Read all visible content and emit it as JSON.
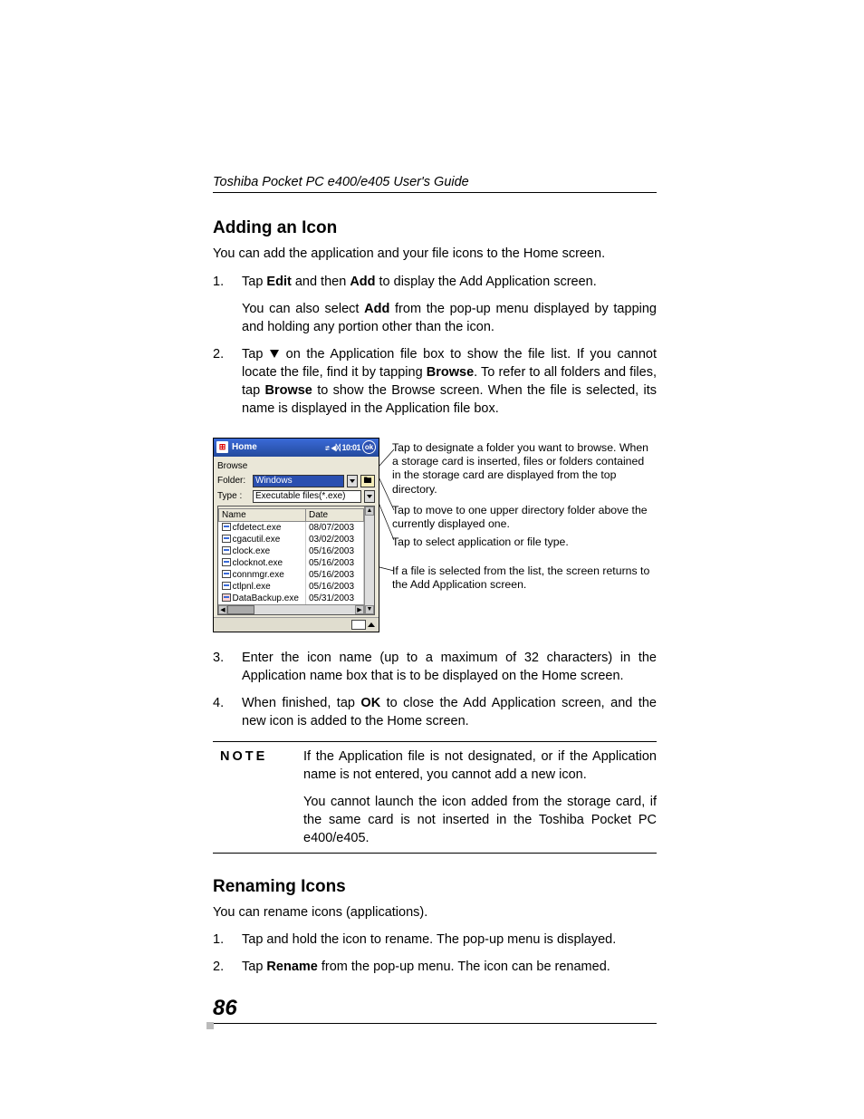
{
  "running_head": "Toshiba Pocket PC  e400/e405 User's Guide",
  "section1": {
    "heading": "Adding an Icon",
    "intro": "You can add the application and your file icons to the Home screen.",
    "steps": {
      "s1": {
        "n": "1.",
        "a": "Tap ",
        "b1": "Edit",
        "b": " and then ",
        "b2": "Add",
        "c": " to display the Add Application screen."
      },
      "s1sub": {
        "a": "You can also select ",
        "b": "Add",
        "c": " from the pop-up menu displayed by tapping and holding any portion other than the icon."
      },
      "s2": {
        "n": "2.",
        "a": "Tap ",
        "b": " on the Application file box to show the file list. If you cannot locate the file, find it by tapping ",
        "b1": "Browse",
        "c": ". To refer to all folders and files, tap ",
        "b2": "Browse",
        "d": " to show the Browse screen. When the file is selected, its name is displayed in the Application file box."
      },
      "s3": {
        "n": "3.",
        "t": "Enter the icon name (up to a maximum of 32 characters) in the Application name box that is to be displayed on the Home screen."
      },
      "s4": {
        "n": "4.",
        "a": "When finished, tap ",
        "b": "OK",
        "c": " to close the Add Application screen, and the new icon is  added to the Home screen."
      }
    }
  },
  "figure": {
    "titlebar": {
      "app": "Home",
      "status": "⇄ ◀ᛞ 10:01",
      "ok": "ok"
    },
    "browse_label": "Browse",
    "folder": {
      "label": "Folder:",
      "value": "Windows"
    },
    "type": {
      "label": "Type :",
      "value": "Executable files(*.exe)"
    },
    "cols": {
      "name": "Name",
      "date": "Date"
    },
    "rows": [
      {
        "fn": "cfdetect.exe",
        "dt": "08/07/2003"
      },
      {
        "fn": "cgacutil.exe",
        "dt": "03/02/2003"
      },
      {
        "fn": "clock.exe",
        "dt": "05/16/2003"
      },
      {
        "fn": "clocknot.exe",
        "dt": "05/16/2003"
      },
      {
        "fn": "connmgr.exe",
        "dt": "05/16/2003"
      },
      {
        "fn": "ctlpnl.exe",
        "dt": "05/16/2003"
      },
      {
        "fn": "DataBackup.exe",
        "dt": "05/31/2003"
      }
    ],
    "callouts": {
      "c1": "Tap to designate a folder you want to browse. When a storage card is inserted, files or folders contained in the storage card are displayed from the top directory.",
      "c2": "Tap to move to one upper directory folder above the currently displayed one.",
      "c3": "Tap to select application or file type.",
      "c4": "If a file is selected from the list, the screen returns to the Add Application screen."
    }
  },
  "note": {
    "label": "NOTE",
    "p1": "If the Application file is not designated, or if the Application name is not entered, you cannot add a new icon.",
    "p2": "You cannot launch the icon added from the storage card, if the same card is not inserted in the Toshiba Pocket PC e400/e405."
  },
  "section2": {
    "heading": "Renaming Icons",
    "intro": "You can rename icons (applications).",
    "steps": {
      "s1": {
        "n": "1.",
        "t": "Tap and hold the icon to rename. The pop-up menu is displayed."
      },
      "s2": {
        "n": "2.",
        "a": "Tap ",
        "b": "Rename",
        "c": " from the pop-up menu. The icon can be renamed."
      }
    }
  },
  "page_number": "86"
}
